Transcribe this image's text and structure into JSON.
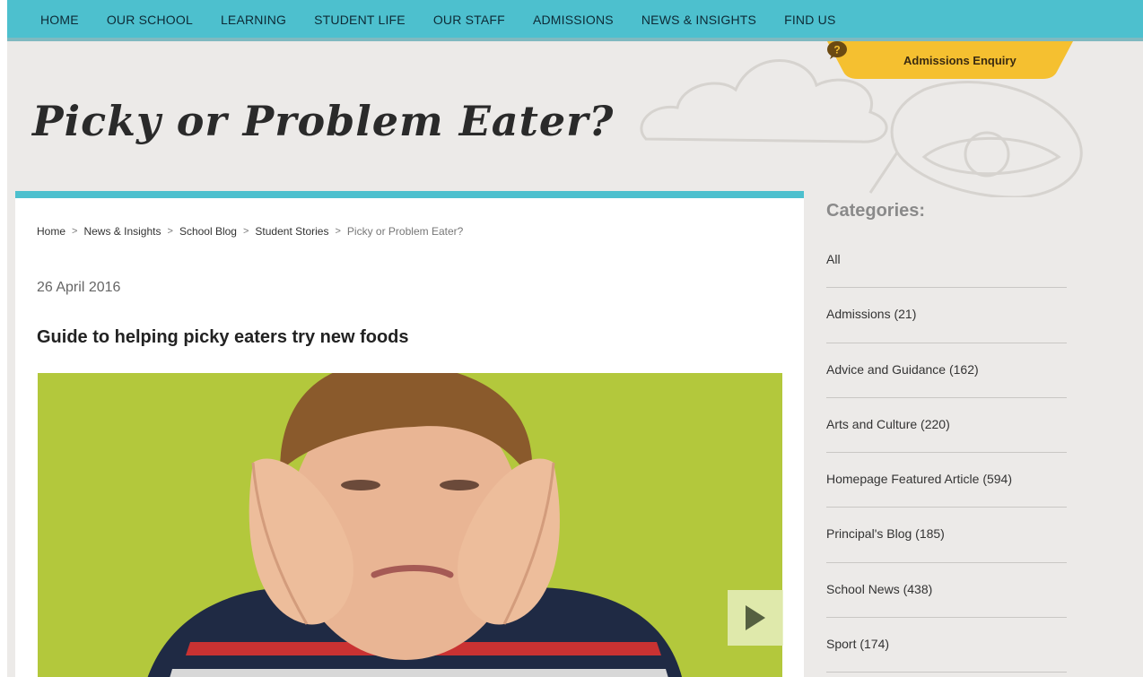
{
  "nav": {
    "items": [
      "HOME",
      "OUR SCHOOL",
      "LEARNING",
      "STUDENT LIFE",
      "OUR STAFF",
      "ADMISSIONS",
      "NEWS & INSIGHTS",
      "FIND US"
    ]
  },
  "enquiry": {
    "label": "Admissions Enquiry",
    "icon": "question-icon"
  },
  "hero": {
    "title": "Picky or Problem Eater?"
  },
  "breadcrumb": {
    "items": [
      "Home",
      "News & Insights",
      "School Blog",
      "Student Stories"
    ],
    "current": "Picky or Problem Eater?",
    "separator": ">"
  },
  "article": {
    "date": "26 April 2016",
    "headline": "Guide to helping picky eaters try new foods"
  },
  "sidebar": {
    "title": "Categories:",
    "categories": [
      "All",
      "Admissions (21)",
      "Advice and Guidance (162)",
      "Arts and Culture (220)",
      "Homepage Featured Article (594)",
      "Principal's Blog (185)",
      "School News (438)",
      "Sport (174)"
    ]
  },
  "colors": {
    "nav_bg": "#4dc0ce",
    "enquiry_bg": "#f5c030",
    "image_bg": "#b3c83c",
    "page_bg": "#eceae8"
  }
}
